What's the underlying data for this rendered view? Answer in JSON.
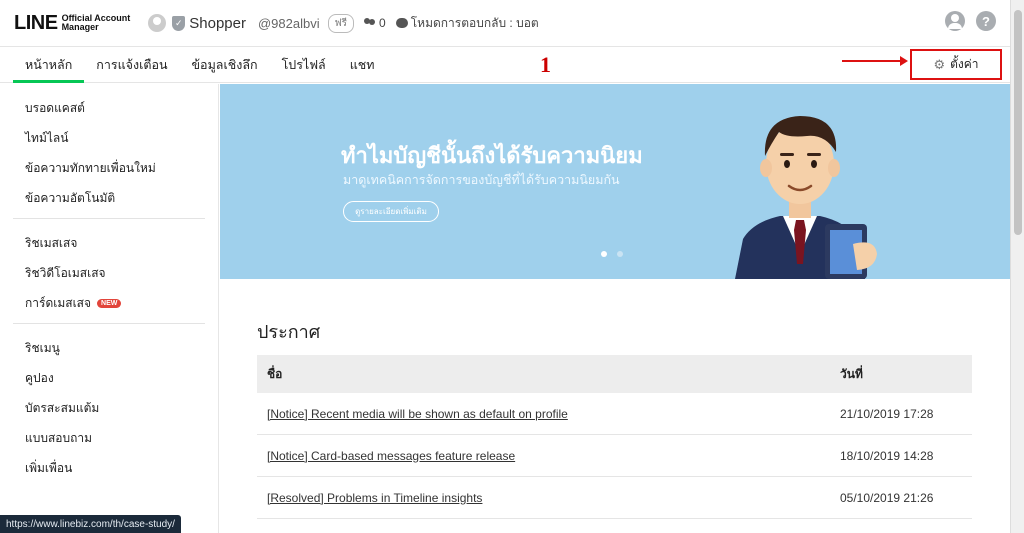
{
  "header": {
    "logo_main": "LINE",
    "logo_sub1": "Official Account",
    "logo_sub2": "Manager",
    "account_name": "Shopper",
    "account_id": "@982albvi",
    "plan_badge": "ฟรี",
    "friend_count": "0",
    "reply_mode": "โหมดการตอบกลับ : บอต",
    "icons": [
      "user-icon",
      "help-icon"
    ],
    "help_glyph": "?"
  },
  "nav": {
    "tabs": [
      "หน้าหลัก",
      "การแจ้งเตือน",
      "ข้อมูลเชิงลึก",
      "โปรไฟล์",
      "แชท"
    ],
    "active_tab": "หน้าหลัก",
    "settings_label": "ตั้งค่า",
    "annotation_number": "1"
  },
  "sidebar": {
    "group1": [
      "บรอดแคสต์",
      "ไทม์ไลน์",
      "ข้อความทักทายเพื่อนใหม่",
      "ข้อความอัตโนมัติ"
    ],
    "group2": [
      "ริชเมสเสจ",
      "ริชวิดีโอเมสเสจ",
      "การ์ดเมสเสจ"
    ],
    "new_badge": "NEW",
    "group3": [
      "ริชเมนู",
      "คูปอง",
      "บัตรสะสมแต้ม",
      "แบบสอบถาม",
      "เพิ่มเพื่อน"
    ]
  },
  "banner": {
    "title": "ทำไมบัญชีนั้นถึงได้รับความนิยม",
    "subtitle": "มาดูเทคนิคการจัดการของบัญชีที่ได้รับความนิยมกัน",
    "button_label": "ดูรายละเอียดเพิ่มเติม",
    "slide_count": 2,
    "active_slide": 1
  },
  "announcements": {
    "title": "ประกาศ",
    "columns": [
      "ชื่อ",
      "วันที่"
    ],
    "rows": [
      {
        "name": "[Notice] Recent media will be shown as default on profile",
        "date": "21/10/2019 17:28"
      },
      {
        "name": "[Notice] Card-based messages feature release",
        "date": "18/10/2019 14:28"
      },
      {
        "name": "[Resolved] Problems in Timeline insights",
        "date": "05/10/2019 21:26"
      }
    ]
  },
  "status_url": "https://www.linebiz.com/th/case-study/",
  "colors": {
    "accent_green": "#06c755",
    "banner_bg": "#9fd0ec",
    "annotation_red": "#dd1111"
  }
}
